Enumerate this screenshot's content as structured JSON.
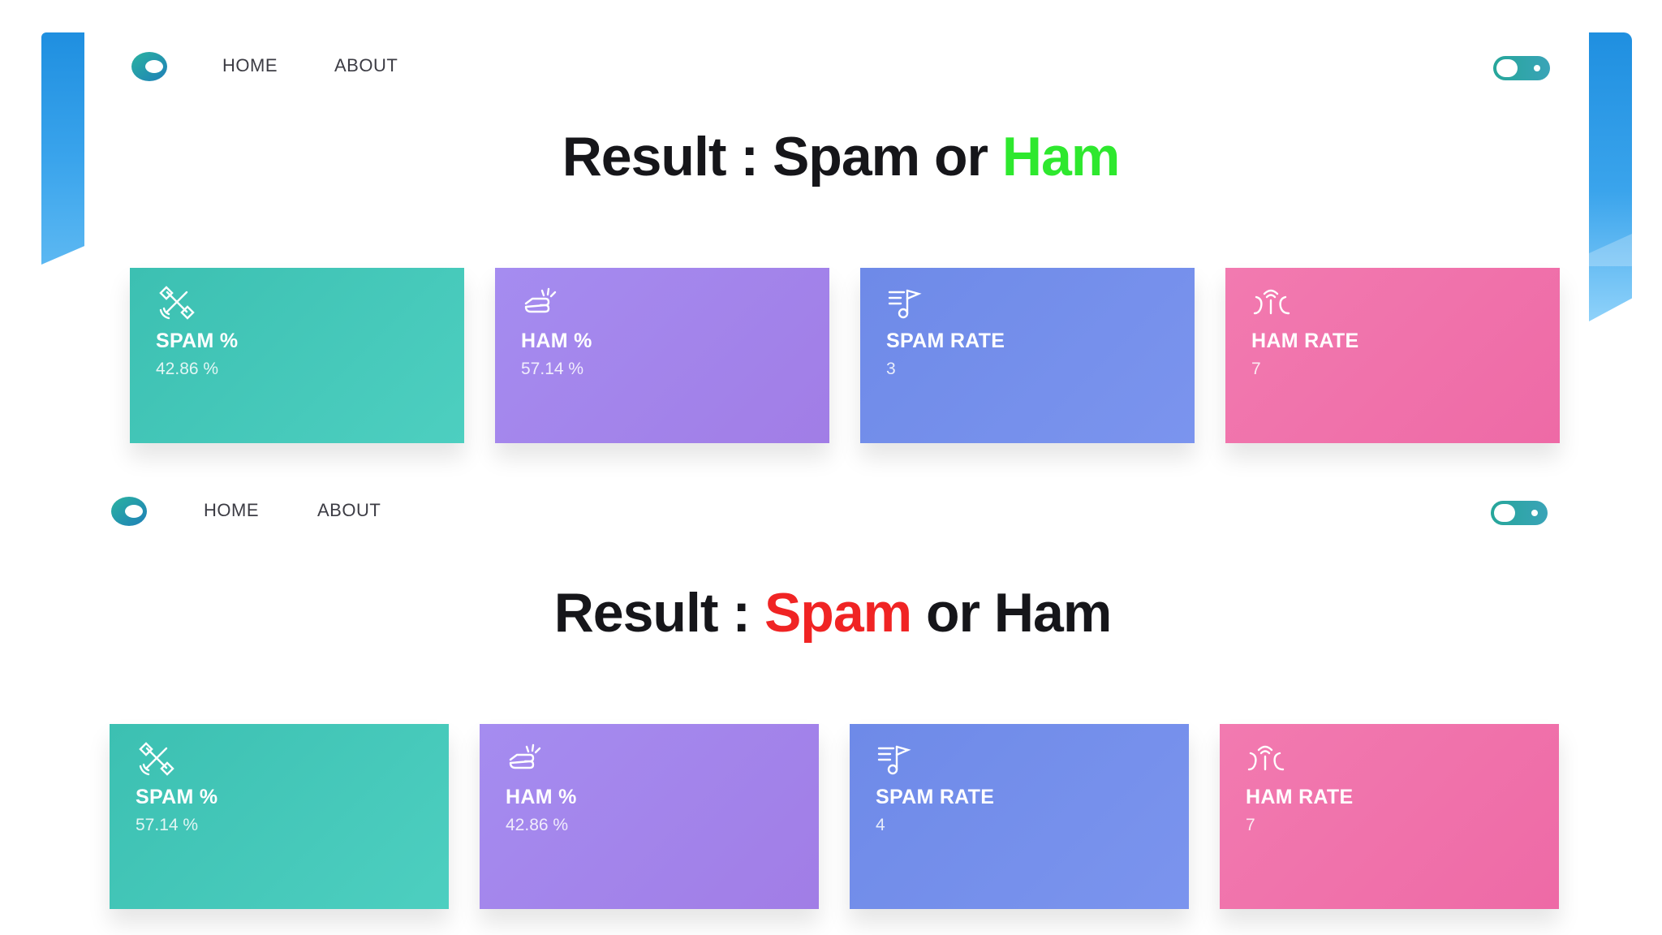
{
  "colors": {
    "accent_blue": "#2196e6",
    "ham_highlight": "#2ee82e",
    "spam_highlight": "#f02424",
    "card_teal": "#44c7b9",
    "card_purple": "#a586ec",
    "card_blue": "#7490eb",
    "card_pink": "#f073ac"
  },
  "screens": [
    {
      "nav": {
        "home": "HOME",
        "about": "ABOUT"
      },
      "title": {
        "prefix": "Result : ",
        "spam": "Spam",
        "middle": " or ",
        "ham": "Ham",
        "highlighted": "ham"
      },
      "cards": [
        {
          "icon": "satellite-icon",
          "label": "SPAM %",
          "value": "42.86 %"
        },
        {
          "icon": "hand-icon",
          "label": "HAM %",
          "value": "57.14 %"
        },
        {
          "icon": "music-note-icon",
          "label": "SPAM RATE",
          "value": "3"
        },
        {
          "icon": "signal-waves-icon",
          "label": "HAM RATE",
          "value": "7"
        }
      ]
    },
    {
      "nav": {
        "home": "HOME",
        "about": "ABOUT"
      },
      "title": {
        "prefix": "Result : ",
        "spam": "Spam",
        "middle": " or ",
        "ham": "Ham",
        "highlighted": "spam"
      },
      "cards": [
        {
          "icon": "satellite-icon",
          "label": "SPAM %",
          "value": "57.14 %"
        },
        {
          "icon": "hand-icon",
          "label": "HAM %",
          "value": "42.86 %"
        },
        {
          "icon": "music-note-icon",
          "label": "SPAM RATE",
          "value": "4"
        },
        {
          "icon": "signal-waves-icon",
          "label": "HAM RATE",
          "value": "7"
        }
      ]
    }
  ]
}
